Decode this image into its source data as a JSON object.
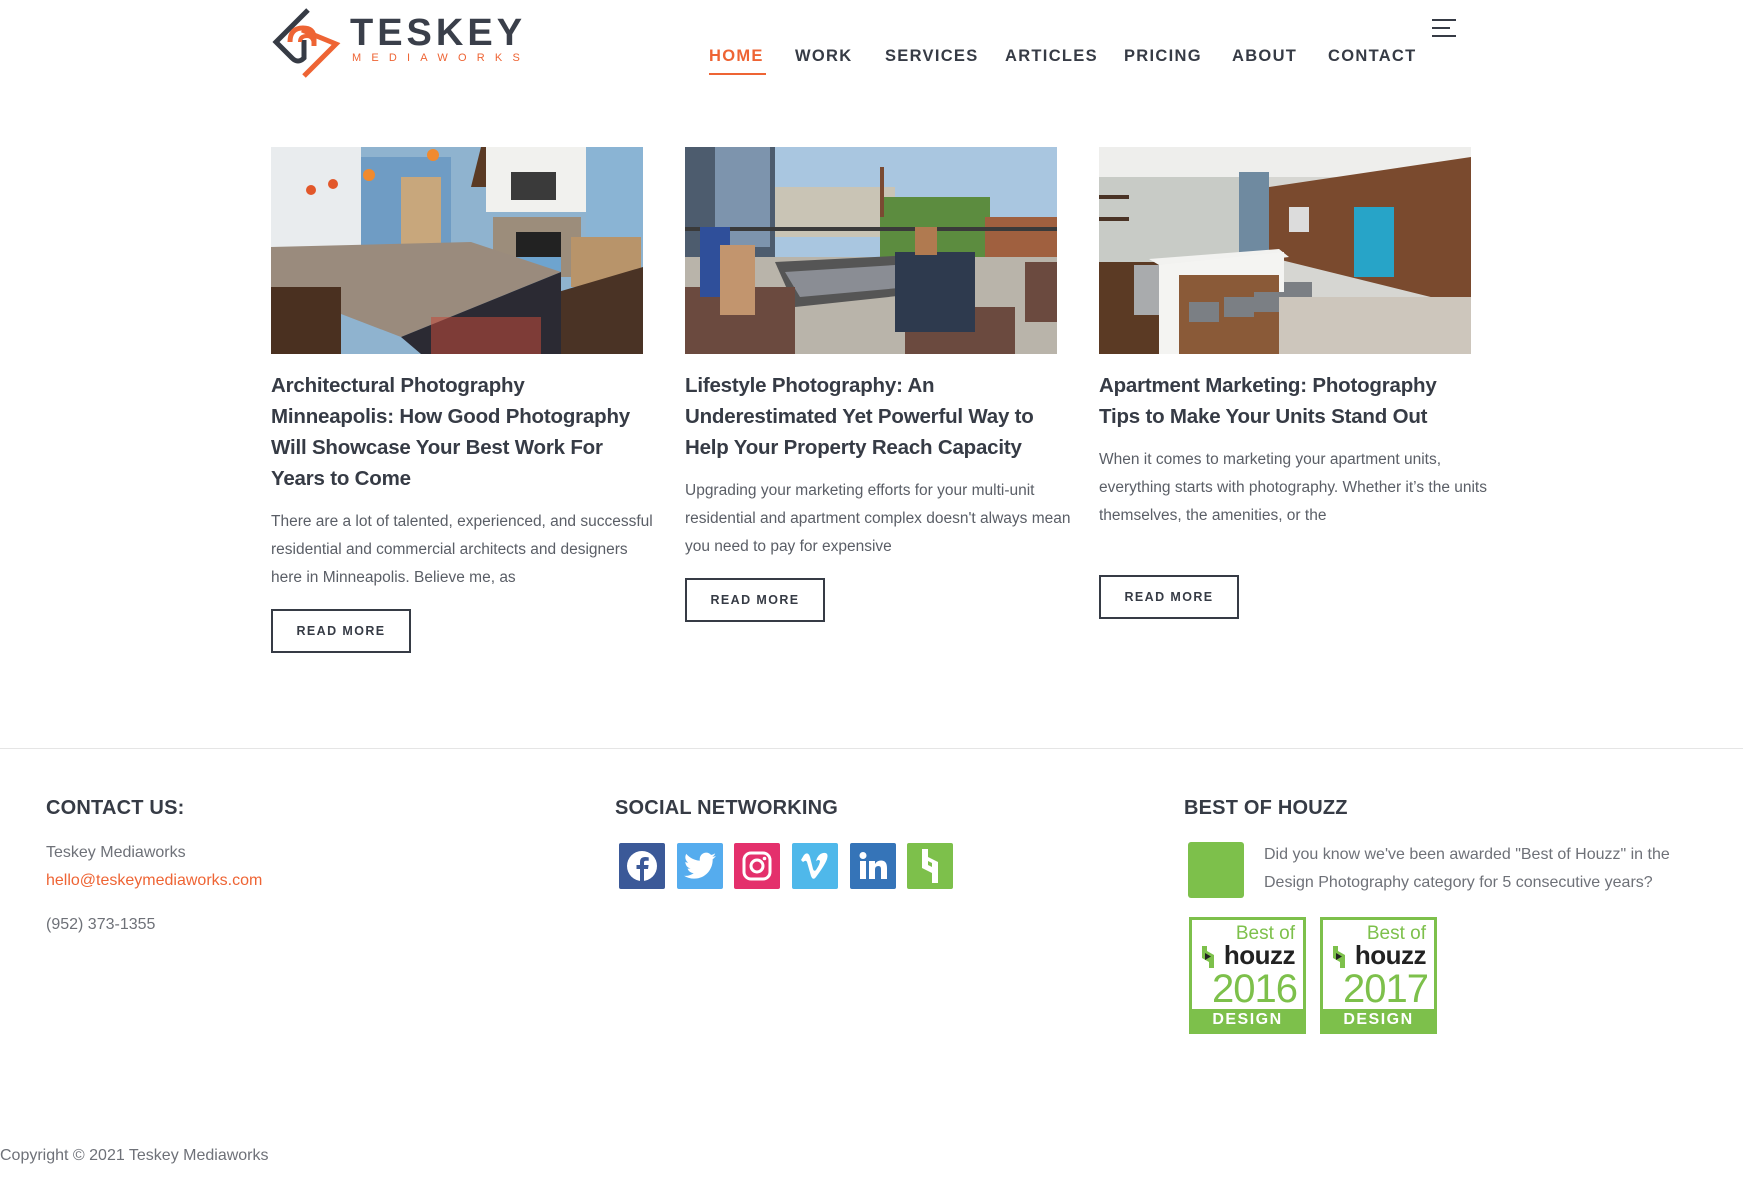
{
  "header": {
    "logo": {
      "title": "TESKEY",
      "subtitle": "MEDIAWORKS"
    },
    "nav": [
      {
        "label": "HOME",
        "active": true
      },
      {
        "label": "WORK",
        "active": false
      },
      {
        "label": "SERVICES",
        "active": false
      },
      {
        "label": "ARTICLES",
        "active": false
      },
      {
        "label": "PRICING",
        "active": false
      },
      {
        "label": "ABOUT",
        "active": false
      },
      {
        "label": "CONTACT",
        "active": false
      }
    ],
    "menu_icon": "hamburger-menu-icon"
  },
  "articles": [
    {
      "image_alt": "Kitchen and living room interior with stone fireplace",
      "title": "Architectural Photography Minneapolis: How Good Photography Will Showcase Your Best Work For Years to Come",
      "excerpt": "There are a lot of talented, experienced, and successful residential and commercial architects and designers here in Minneapolis. Believe me, as",
      "button_label": "READ MORE"
    },
    {
      "image_alt": "People relaxing around rooftop fire pit",
      "title": "Lifestyle Photography: An Underestimated Yet Powerful Way to Help Your Property Reach Capacity",
      "excerpt": "Upgrading your marketing efforts for your multi-unit residential and apartment complex doesn't always mean you need to pay for expensive",
      "button_label": "READ MORE"
    },
    {
      "image_alt": "Apartment kitchen with wood wall and bar stools",
      "title": "Apartment Marketing: Photography Tips to Make Your Units Stand Out",
      "excerpt": "When it comes to marketing your apartment units, everything starts with photography. Whether it’s the units themselves, the amenities, or the",
      "button_label": "READ MORE"
    }
  ],
  "footer": {
    "contact": {
      "heading": "CONTACT US:",
      "company": "Teskey Mediaworks",
      "email": "hello@teskeymediaworks.com",
      "phone": "(952) 373-1355"
    },
    "social": {
      "heading": "SOCIAL NETWORKING",
      "icons": [
        {
          "name": "facebook-icon",
          "color": "#3b5998"
        },
        {
          "name": "twitter-icon",
          "color": "#55acee"
        },
        {
          "name": "instagram-icon",
          "color": "#e4306c"
        },
        {
          "name": "vimeo-icon",
          "color": "#4fb8ea"
        },
        {
          "name": "linkedin-icon",
          "color": "#3574b8"
        },
        {
          "name": "houzz-icon",
          "color": "#7dc04b"
        }
      ]
    },
    "houzz": {
      "heading": "BEST OF HOUZZ",
      "text": "Did you know we've been awarded \"Best of Houzz\" in the Design Photography category for 5 consecutive years?",
      "badges": [
        {
          "best_of": "Best of",
          "brand": "houzz",
          "year": "2016",
          "category": "DESIGN"
        },
        {
          "best_of": "Best of",
          "brand": "houzz",
          "year": "2017",
          "category": "DESIGN"
        }
      ]
    },
    "copyright": "Copyright © 2021 Teskey Mediaworks"
  },
  "colors": {
    "accent": "#ee6434",
    "text_dark": "#363b45",
    "houzz_green": "#7dc04b"
  }
}
